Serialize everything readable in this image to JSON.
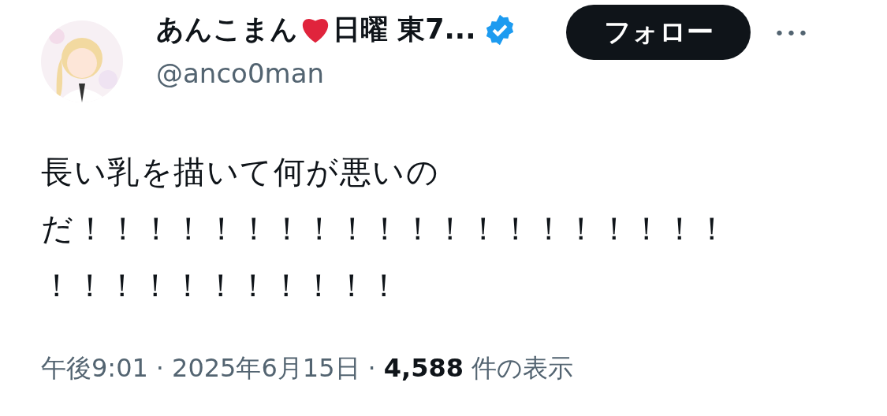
{
  "author": {
    "name_before_heart": "あんこまん",
    "name_after_heart": "日曜 東7...",
    "verified": true,
    "handle": "@anco0man"
  },
  "follow_button": "フォロー",
  "more_button": "•••",
  "body_lines": [
    "長い乳を描いて何が悪いの",
    "だ！！！！！！！！！！！！！！！！！！！！",
    "！！！！！！！！！！！"
  ],
  "meta": {
    "time": "午後9:01",
    "separator_1": "·",
    "date": "2025年6月15日",
    "separator_2": "·",
    "views": "4,588",
    "views_label": "件の表示"
  }
}
